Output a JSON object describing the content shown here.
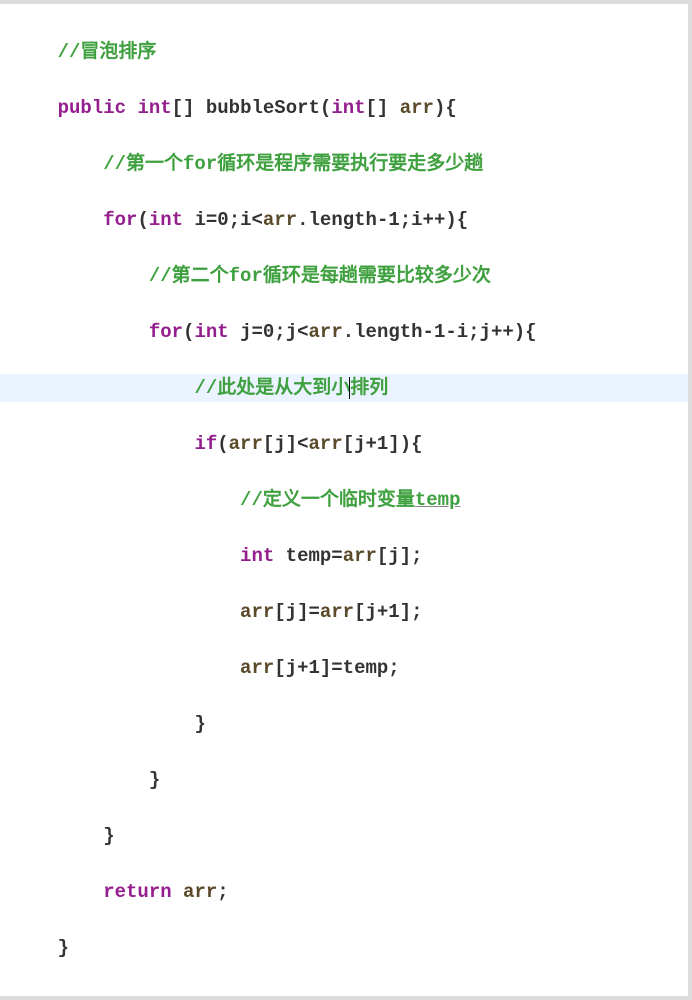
{
  "code": {
    "l1_comment": "//冒泡排序",
    "l2_kw1": "public",
    "l2_kw2": "int",
    "l2_brackets1": "[] ",
    "l2_method": "bubbleSort",
    "l2_paren_open": "(",
    "l2_kw3": "int",
    "l2_after_param": "[] ",
    "l2_param": "arr",
    "l2_tail": "){",
    "l3_comment_a": "//第一个",
    "l3_comment_b": "for",
    "l3_comment_c": "循环是程序需要执行要走多少趟",
    "l4_kw": "for",
    "l4_a": "(",
    "l4_kw2": "int",
    "l4_b": " i=",
    "l4_num": "0",
    "l4_c": ";i<",
    "l4_param1": "arr",
    "l4_d": ".length-1;i++){",
    "l5_comment_a": "//第二个",
    "l5_comment_b": "for",
    "l5_comment_c": "循环是每趟需要比较多少次",
    "l6_kw": "for",
    "l6_a": "(",
    "l6_kw2": "int",
    "l6_b": " j=",
    "l6_num": "0",
    "l6_c": ";j<",
    "l6_param1": "arr",
    "l6_d": ".length-1-i;j++){",
    "l7_comment_a": "//此处是从大到小",
    "l7_comment_b": "排列",
    "l8_kw": "if",
    "l8_a": "(",
    "l8_p1": "arr",
    "l8_b": "[j]<",
    "l8_p2": "arr",
    "l8_c": "[j+1]){",
    "l9_comment_a": "//定义一个临时变量",
    "l9_comment_b": "temp",
    "l10_kw": "int",
    "l10_a": " temp=",
    "l10_p": "arr",
    "l10_b": "[j];",
    "l11_p1": "arr",
    "l11_a": "[j]=",
    "l11_p2": "arr",
    "l11_b": "[j+1];",
    "l12_p": "arr",
    "l12_a": "[j+1]=temp;",
    "l13": "}",
    "l14": "}",
    "l15": "}",
    "l16_kw": "return",
    "l16_a": " ",
    "l16_p": "arr",
    "l16_b": ";",
    "l17": "}"
  }
}
